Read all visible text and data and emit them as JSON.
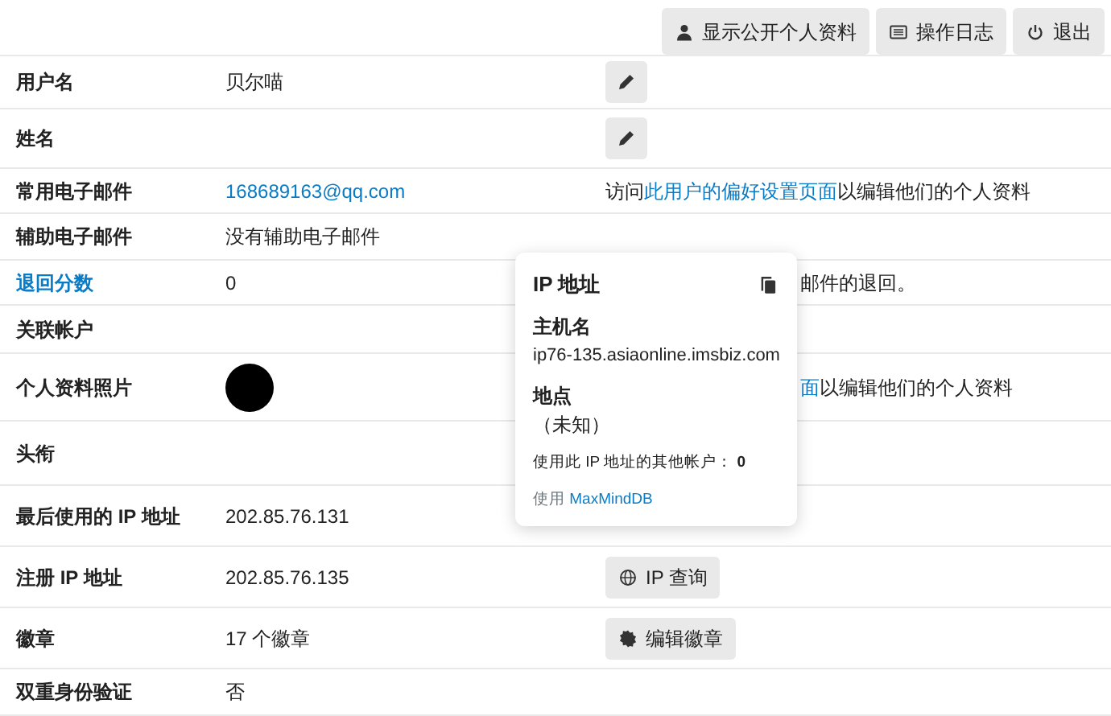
{
  "top_buttons": [
    {
      "kind": "profile",
      "label": "显示公开个人资料"
    },
    {
      "kind": "log",
      "label": "操作日志"
    },
    {
      "kind": "logout",
      "label": "退出"
    }
  ],
  "rows": [
    {
      "label": "用户名",
      "label_link": false,
      "value": {
        "kind": "text",
        "text": "贝尔喵"
      },
      "action": {
        "kind": "edit"
      }
    },
    {
      "label": "姓名",
      "label_link": false,
      "action": {
        "kind": "edit"
      }
    },
    {
      "label": "常用电子邮件",
      "label_link": false,
      "value": {
        "kind": "link",
        "text": "168689163@qq.com"
      },
      "action": {
        "kind": "note",
        "parts": [
          {
            "text": "访问",
            "link": false
          },
          {
            "text": "此用户的偏好设置页面",
            "link": true
          },
          {
            "text": "以编辑他们的个人资料",
            "link": false
          }
        ]
      }
    },
    {
      "label": "辅助电子邮件",
      "label_link": false,
      "value": {
        "kind": "text",
        "text": "没有辅助电子邮件"
      }
    },
    {
      "label": "退回分数",
      "label_link": true,
      "value": {
        "kind": "text",
        "text": "0"
      },
      "action": {
        "kind": "covered-note",
        "parts": [
          {
            "text": "邮件的退回。",
            "link": false
          }
        ]
      }
    },
    {
      "label": "关联帐户",
      "label_link": false
    },
    {
      "label": "个人资料照片",
      "label_link": false,
      "value": {
        "kind": "avatar"
      },
      "action": {
        "kind": "covered-note",
        "parts": [
          {
            "text": "面",
            "link": true
          },
          {
            "text": "以编辑他们的个人资料",
            "link": false
          }
        ]
      }
    },
    {
      "label": "头衔",
      "label_link": false
    },
    {
      "label": "最后使用的 IP 地址",
      "label_link": false,
      "value": {
        "kind": "text",
        "text": "202.85.76.131"
      }
    },
    {
      "label": "注册 IP 地址",
      "label_link": false,
      "value": {
        "kind": "text",
        "text": "202.85.76.135"
      },
      "action": {
        "kind": "lookup",
        "label": "IP 查询"
      }
    },
    {
      "label": "徽章",
      "label_link": false,
      "value": {
        "kind": "text",
        "text": "17 个徽章"
      },
      "action": {
        "kind": "badges",
        "label": "编辑徽章"
      }
    },
    {
      "label": "双重身份验证",
      "label_link": false,
      "value": {
        "kind": "text",
        "text": "否"
      }
    }
  ],
  "popover": {
    "title": "IP 地址",
    "hostname_label": "主机名",
    "hostname": "ip76-135.asiaonline.imsbiz.com",
    "location_label": "地点",
    "location": "（未知）",
    "other_accounts_label": "使用此 IP 地址的其他帐户：",
    "other_accounts_count": "0",
    "source_prefix": "使用",
    "source_link": "MaxMindDB"
  }
}
